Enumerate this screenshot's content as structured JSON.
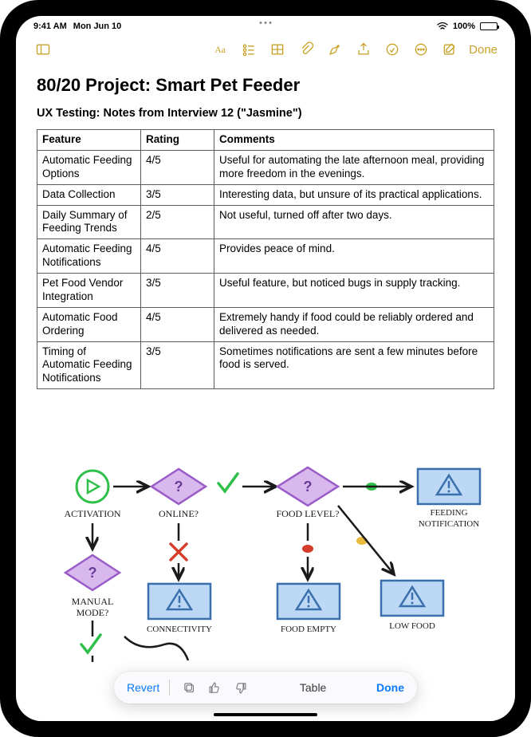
{
  "status": {
    "time": "9:41 AM",
    "date": "Mon Jun 10",
    "battery_pct": "100%"
  },
  "toolbar": {
    "done": "Done"
  },
  "note": {
    "title": "80/20 Project: Smart Pet Feeder",
    "subtitle": "UX Testing: Notes from Interview 12 (\"Jasmine\")"
  },
  "table": {
    "headers": {
      "feature": "Feature",
      "rating": "Rating",
      "comments": "Comments"
    },
    "rows": [
      {
        "feature": "Automatic Feeding Options",
        "rating": "4/5",
        "comments": "Useful for automating the late afternoon meal, providing more freedom in the evenings."
      },
      {
        "feature": "Data Collection",
        "rating": "3/5",
        "comments": "Interesting data, but unsure of its practical applications."
      },
      {
        "feature": "Daily Summary of Feeding Trends",
        "rating": "2/5",
        "comments": "Not useful, turned off after two days."
      },
      {
        "feature": "Automatic Feeding Notifications",
        "rating": "4/5",
        "comments": "Provides peace of mind."
      },
      {
        "feature": "Pet Food Vendor Integration",
        "rating": "3/5",
        "comments": "Useful feature, but noticed bugs in supply tracking."
      },
      {
        "feature": "Automatic Food Ordering",
        "rating": "4/5",
        "comments": "Extremely handy if food could be reliably ordered and delivered as needed."
      },
      {
        "feature": "Timing of Automatic Feeding Notifications",
        "rating": "3/5",
        "comments": "Sometimes notifications are sent a few minutes before food is served."
      }
    ]
  },
  "diagram": {
    "activation": "ACTIVATION",
    "online": "ONLINE?",
    "food_level": "FOOD LEVEL?",
    "feeding_notification_l1": "FEEDING",
    "feeding_notification_l2": "NOTIFICATION",
    "manual_mode": "MANUAL",
    "manual_mode_l2": "MODE?",
    "connectivity": "CONNECTIVITY",
    "food_empty": "FOOD EMPTY",
    "low_food": "LOW FOOD"
  },
  "popup": {
    "revert": "Revert",
    "label": "Table",
    "done": "Done"
  }
}
